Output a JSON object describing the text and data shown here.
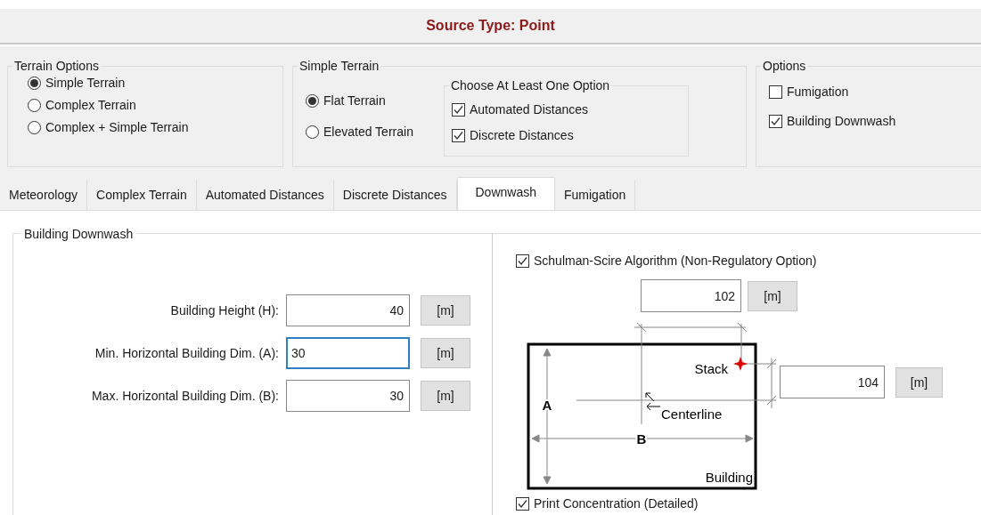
{
  "title": "Source Type: Point",
  "terrain_options": {
    "label": "Terrain Options",
    "options": [
      {
        "label": "Simple Terrain",
        "selected": true
      },
      {
        "label": "Complex Terrain",
        "selected": false
      },
      {
        "label": "Complex + Simple Terrain",
        "selected": false
      }
    ]
  },
  "simple_terrain": {
    "label": "Simple Terrain",
    "options": [
      {
        "label": "Flat Terrain",
        "selected": true
      },
      {
        "label": "Elevated Terrain",
        "selected": false
      }
    ],
    "distance_group": {
      "label": "Choose At Least One Option",
      "items": [
        {
          "label": "Automated Distances",
          "checked": true
        },
        {
          "label": "Discrete Distances",
          "checked": true
        }
      ]
    }
  },
  "options": {
    "label": "Options",
    "items": [
      {
        "label": "Fumigation",
        "checked": false
      },
      {
        "label": "Building Downwash",
        "checked": true
      }
    ]
  },
  "tabs": [
    {
      "label": "Meteorology",
      "selected": false
    },
    {
      "label": "Complex Terrain",
      "selected": false
    },
    {
      "label": "Automated Distances",
      "selected": false
    },
    {
      "label": "Discrete Distances",
      "selected": false
    },
    {
      "label": "Downwash",
      "selected": true
    },
    {
      "label": "Fumigation",
      "selected": false
    }
  ],
  "downwash": {
    "label": "Building Downwash",
    "fields": [
      {
        "label": "Building Height (H):",
        "value": "40",
        "unit": "[m]",
        "focused": false
      },
      {
        "label": "Min. Horizontal Building Dim. (A):",
        "value": "30",
        "unit": "[m]",
        "focused": true
      },
      {
        "label": "Max. Horizontal Building Dim. (B):",
        "value": "30",
        "unit": "[m]",
        "focused": false
      }
    ],
    "schulman": {
      "label": "Schulman-Scire Algorithm (Non-Regulatory Option)",
      "checked": true
    },
    "diagram": {
      "top_field": {
        "value": "102",
        "unit": "[m]"
      },
      "side_field": {
        "value": "104",
        "unit": "[m]"
      },
      "stack": "Stack",
      "centerline": "Centerline",
      "building": "Building",
      "a": "A",
      "b": "B"
    },
    "print_detailed": {
      "label": "Print Concentration (Detailed)",
      "checked": true
    }
  }
}
